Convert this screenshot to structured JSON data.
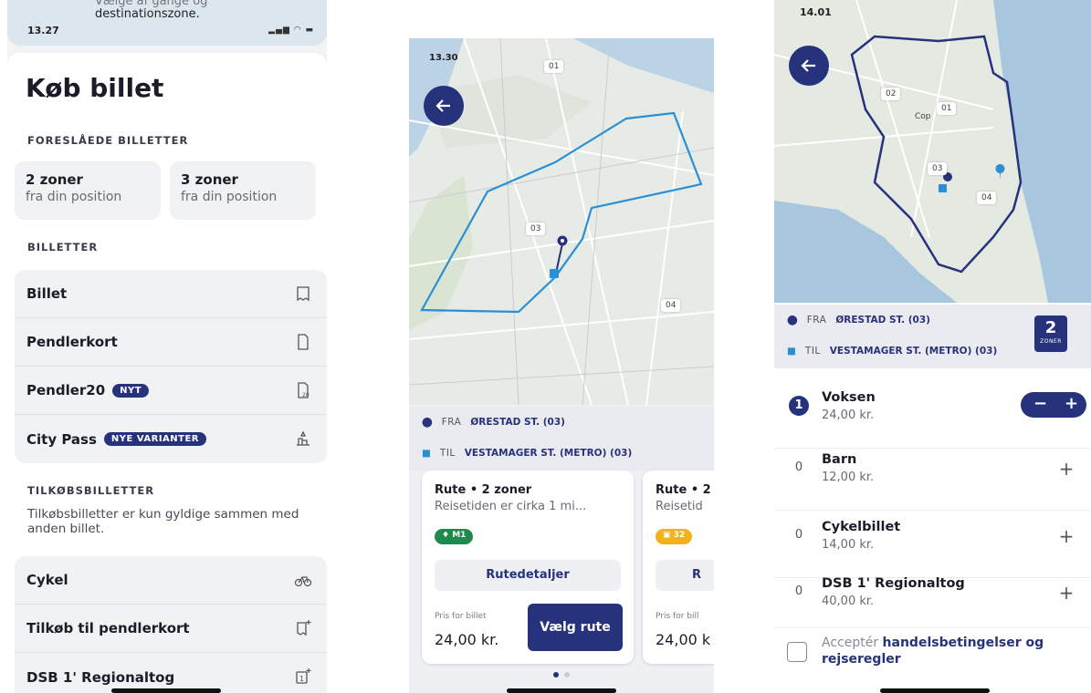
{
  "screen1": {
    "time": "13.27",
    "strip_text_line1": "Vælge af gange og",
    "strip_text_line2": "destinationszone.",
    "title": "Køb billet",
    "suggested_header": "FORESLÅEDE BILLETTER",
    "suggested": [
      {
        "title": "2 zoner",
        "sub": "fra din position"
      },
      {
        "title": "3 zoner",
        "sub": "fra din position"
      }
    ],
    "tickets_header": "BILLETTER",
    "tickets": [
      {
        "label": "Billet",
        "badge": "",
        "icon": "ticket-icon"
      },
      {
        "label": "Pendlerkort",
        "badge": "",
        "icon": "card-icon"
      },
      {
        "label": "Pendler20",
        "badge": "NYT",
        "icon": "ticket-20-icon"
      },
      {
        "label": "City Pass",
        "badge": "NYE VARIANTER",
        "icon": "citypass-icon"
      }
    ],
    "addon_header": "TILKØBSBILLETTER",
    "addon_desc": "Tilkøbsbilletter er kun gyldige sammen med anden billet.",
    "addons": [
      {
        "label": "Cykel",
        "icon": "bicycle-icon"
      },
      {
        "label": "Tilkøb til pendlerkort",
        "icon": "add-card-icon"
      },
      {
        "label": "DSB 1' Regionaltog",
        "icon": "add-ticket-icon"
      }
    ]
  },
  "screen2": {
    "time": "13.30",
    "zones": [
      "01",
      "03",
      "04"
    ],
    "from_prefix": "FRA",
    "from": "ØRESTAD ST. (03)",
    "to_prefix": "TIL",
    "to": "VESTAMAGER ST. (METRO) (03)",
    "cards": [
      {
        "title": "Rute • 2 zoner",
        "sub": "Reisetiden er cirka 1 mi...",
        "pill": "M1",
        "pill_color": "#1f8a4c",
        "details": "Rutedetaljer",
        "price_label": "Pris for billet",
        "price": "24,00 kr.",
        "choose": "Vælg rute"
      },
      {
        "title": "Rute • 2",
        "sub": "Reisetid",
        "pill": "32",
        "pill_color": "#f2b21b",
        "details": "R",
        "price_label": "Pris for bill",
        "price": "24,00 k"
      }
    ]
  },
  "screen3": {
    "time": "14.01",
    "zones": [
      "02",
      "01",
      "03",
      "04"
    ],
    "city_label": "Cop",
    "from_prefix": "FRA",
    "from": "ØRESTAD ST. (03)",
    "to_prefix": "TIL",
    "to": "VESTAMAGER ST. (METRO) (03)",
    "zone_count": "2",
    "zone_word": "ZONER",
    "passengers": [
      {
        "count": "1",
        "name": "Voksen",
        "price": "24,00 kr."
      },
      {
        "count": "0",
        "name": "Barn",
        "price": "12,00 kr."
      },
      {
        "count": "0",
        "name": "Cykelbillet",
        "price": "14,00 kr."
      },
      {
        "count": "0",
        "name": "DSB 1' Regionaltog",
        "price": "40,00 kr."
      }
    ],
    "stepper_minus": "−",
    "stepper_plus": "+",
    "plus_glyph": "+",
    "accept_prefix": "Acceptér",
    "accept_link": "handelsbetingelser og rejseregler"
  },
  "colors": {
    "brand": "#27327d",
    "route_line": "#2b8fd6",
    "metro_green": "#1f8a4c",
    "bus_yellow": "#f2b21b"
  }
}
